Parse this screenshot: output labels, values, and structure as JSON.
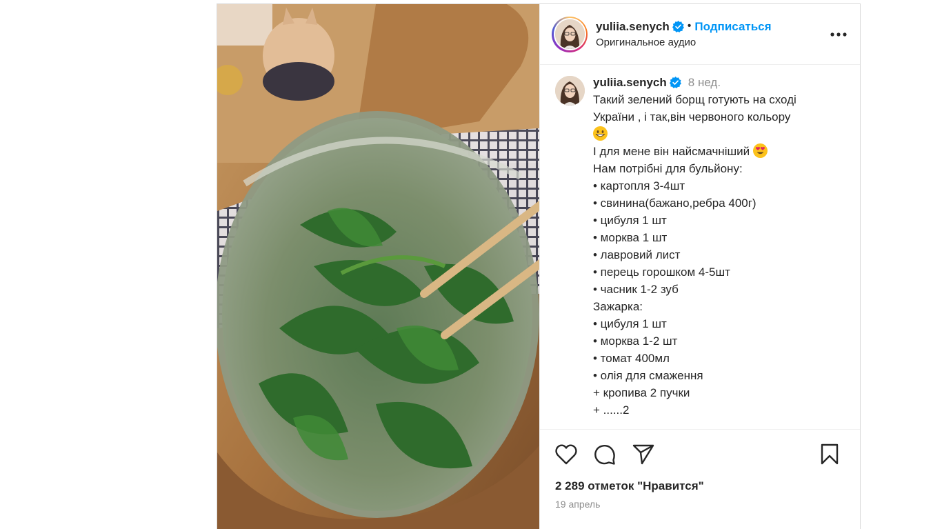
{
  "post": {
    "author": {
      "username": "yuliia.senych",
      "verified_icon": "verified-badge-icon",
      "separator": "•",
      "follow_label": "Подписаться",
      "subtitle": "Оригинальное аудио"
    },
    "more_icon": "more-options-icon",
    "caption": {
      "username": "yuliia.senych",
      "time": "8 нед.",
      "lines": [
        "Такий зелений борщ готують на сході",
        "України , і так,він червоного кольору",
        "",
        "І для мене він найсмачніший",
        "",
        "Нам потрібні для бульйону:",
        "• картопля 3-4шт",
        "• свинина(бажано,ребра 400г)",
        "• цибуля 1 шт",
        "• морква 1 шт",
        "• лавровий лист",
        "• перець горошком 4-5шт",
        "• часник 1-2 зуб",
        "Зажарка:",
        "• цибуля 1 шт",
        "• морква 1-2 шт",
        "• томат 400мл",
        "• олія для смаження",
        "+ кропива 2 пучки",
        "+ ......2"
      ]
    },
    "actions": {
      "like_icon": "heart-icon",
      "comment_icon": "comment-icon",
      "share_icon": "paper-plane-icon",
      "save_icon": "bookmark-icon"
    },
    "likes_text": "2 289 отметок \"Нравится\"",
    "date": "19 апрель",
    "colors": {
      "follow": "#0095f6",
      "verified": "#0095f6",
      "secondary_text": "#8e8e8e"
    }
  }
}
